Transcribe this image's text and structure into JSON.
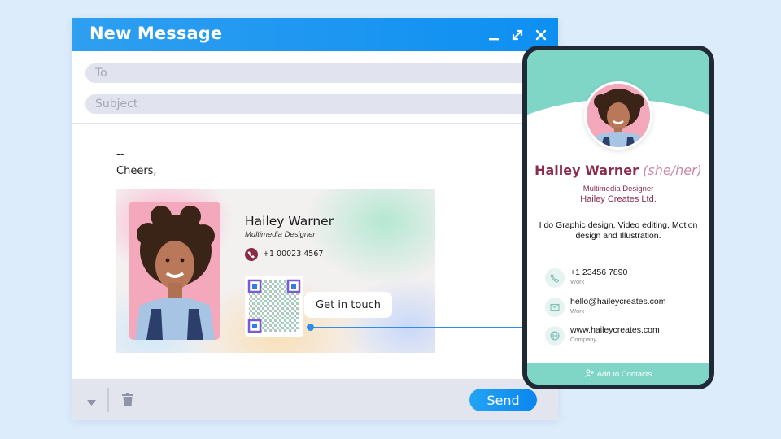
{
  "compose": {
    "title": "New Message",
    "to_placeholder": "To",
    "subject_placeholder": "Subject",
    "body_lines": [
      "--",
      "Cheers,"
    ],
    "send_label": "Send"
  },
  "signature": {
    "name": "Hailey Warner",
    "role": "Multimedia Designer",
    "phone": "+1 00023 4567",
    "cta": "Get in touch"
  },
  "card": {
    "name": "Hailey Warner",
    "pronouns": "(she/her)",
    "role": "Multimedia Designer",
    "company": "Hailey Creates Ltd.",
    "bio": "I do Graphic design, Video editing, Motion design and Illustration.",
    "contacts": [
      {
        "value": "+1 23456 7890",
        "label": "Work",
        "icon": "phone-icon"
      },
      {
        "value": "hello@haileycreates.com",
        "label": "Work",
        "icon": "mail-icon"
      },
      {
        "value": "www.haileycreates.com",
        "label": "Company",
        "icon": "globe-icon"
      }
    ],
    "add_label": "Add to Contacts"
  },
  "colors": {
    "background": "#dcecfb",
    "accent_blue": "#0d8ff2",
    "teal": "#7fd6c6",
    "maroon": "#8c2c4b"
  }
}
